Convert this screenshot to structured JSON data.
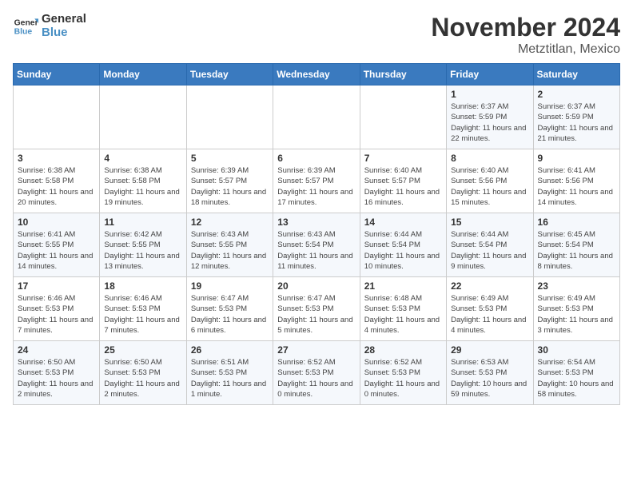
{
  "logo": {
    "line1": "General",
    "line2": "Blue"
  },
  "title": "November 2024",
  "location": "Metztitlan, Mexico",
  "weekdays": [
    "Sunday",
    "Monday",
    "Tuesday",
    "Wednesday",
    "Thursday",
    "Friday",
    "Saturday"
  ],
  "weeks": [
    [
      {
        "day": "",
        "info": ""
      },
      {
        "day": "",
        "info": ""
      },
      {
        "day": "",
        "info": ""
      },
      {
        "day": "",
        "info": ""
      },
      {
        "day": "",
        "info": ""
      },
      {
        "day": "1",
        "info": "Sunrise: 6:37 AM\nSunset: 5:59 PM\nDaylight: 11 hours and 22 minutes."
      },
      {
        "day": "2",
        "info": "Sunrise: 6:37 AM\nSunset: 5:59 PM\nDaylight: 11 hours and 21 minutes."
      }
    ],
    [
      {
        "day": "3",
        "info": "Sunrise: 6:38 AM\nSunset: 5:58 PM\nDaylight: 11 hours and 20 minutes."
      },
      {
        "day": "4",
        "info": "Sunrise: 6:38 AM\nSunset: 5:58 PM\nDaylight: 11 hours and 19 minutes."
      },
      {
        "day": "5",
        "info": "Sunrise: 6:39 AM\nSunset: 5:57 PM\nDaylight: 11 hours and 18 minutes."
      },
      {
        "day": "6",
        "info": "Sunrise: 6:39 AM\nSunset: 5:57 PM\nDaylight: 11 hours and 17 minutes."
      },
      {
        "day": "7",
        "info": "Sunrise: 6:40 AM\nSunset: 5:57 PM\nDaylight: 11 hours and 16 minutes."
      },
      {
        "day": "8",
        "info": "Sunrise: 6:40 AM\nSunset: 5:56 PM\nDaylight: 11 hours and 15 minutes."
      },
      {
        "day": "9",
        "info": "Sunrise: 6:41 AM\nSunset: 5:56 PM\nDaylight: 11 hours and 14 minutes."
      }
    ],
    [
      {
        "day": "10",
        "info": "Sunrise: 6:41 AM\nSunset: 5:55 PM\nDaylight: 11 hours and 14 minutes."
      },
      {
        "day": "11",
        "info": "Sunrise: 6:42 AM\nSunset: 5:55 PM\nDaylight: 11 hours and 13 minutes."
      },
      {
        "day": "12",
        "info": "Sunrise: 6:43 AM\nSunset: 5:55 PM\nDaylight: 11 hours and 12 minutes."
      },
      {
        "day": "13",
        "info": "Sunrise: 6:43 AM\nSunset: 5:54 PM\nDaylight: 11 hours and 11 minutes."
      },
      {
        "day": "14",
        "info": "Sunrise: 6:44 AM\nSunset: 5:54 PM\nDaylight: 11 hours and 10 minutes."
      },
      {
        "day": "15",
        "info": "Sunrise: 6:44 AM\nSunset: 5:54 PM\nDaylight: 11 hours and 9 minutes."
      },
      {
        "day": "16",
        "info": "Sunrise: 6:45 AM\nSunset: 5:54 PM\nDaylight: 11 hours and 8 minutes."
      }
    ],
    [
      {
        "day": "17",
        "info": "Sunrise: 6:46 AM\nSunset: 5:53 PM\nDaylight: 11 hours and 7 minutes."
      },
      {
        "day": "18",
        "info": "Sunrise: 6:46 AM\nSunset: 5:53 PM\nDaylight: 11 hours and 7 minutes."
      },
      {
        "day": "19",
        "info": "Sunrise: 6:47 AM\nSunset: 5:53 PM\nDaylight: 11 hours and 6 minutes."
      },
      {
        "day": "20",
        "info": "Sunrise: 6:47 AM\nSunset: 5:53 PM\nDaylight: 11 hours and 5 minutes."
      },
      {
        "day": "21",
        "info": "Sunrise: 6:48 AM\nSunset: 5:53 PM\nDaylight: 11 hours and 4 minutes."
      },
      {
        "day": "22",
        "info": "Sunrise: 6:49 AM\nSunset: 5:53 PM\nDaylight: 11 hours and 4 minutes."
      },
      {
        "day": "23",
        "info": "Sunrise: 6:49 AM\nSunset: 5:53 PM\nDaylight: 11 hours and 3 minutes."
      }
    ],
    [
      {
        "day": "24",
        "info": "Sunrise: 6:50 AM\nSunset: 5:53 PM\nDaylight: 11 hours and 2 minutes."
      },
      {
        "day": "25",
        "info": "Sunrise: 6:50 AM\nSunset: 5:53 PM\nDaylight: 11 hours and 2 minutes."
      },
      {
        "day": "26",
        "info": "Sunrise: 6:51 AM\nSunset: 5:53 PM\nDaylight: 11 hours and 1 minute."
      },
      {
        "day": "27",
        "info": "Sunrise: 6:52 AM\nSunset: 5:53 PM\nDaylight: 11 hours and 0 minutes."
      },
      {
        "day": "28",
        "info": "Sunrise: 6:52 AM\nSunset: 5:53 PM\nDaylight: 11 hours and 0 minutes."
      },
      {
        "day": "29",
        "info": "Sunrise: 6:53 AM\nSunset: 5:53 PM\nDaylight: 10 hours and 59 minutes."
      },
      {
        "day": "30",
        "info": "Sunrise: 6:54 AM\nSunset: 5:53 PM\nDaylight: 10 hours and 58 minutes."
      }
    ]
  ]
}
